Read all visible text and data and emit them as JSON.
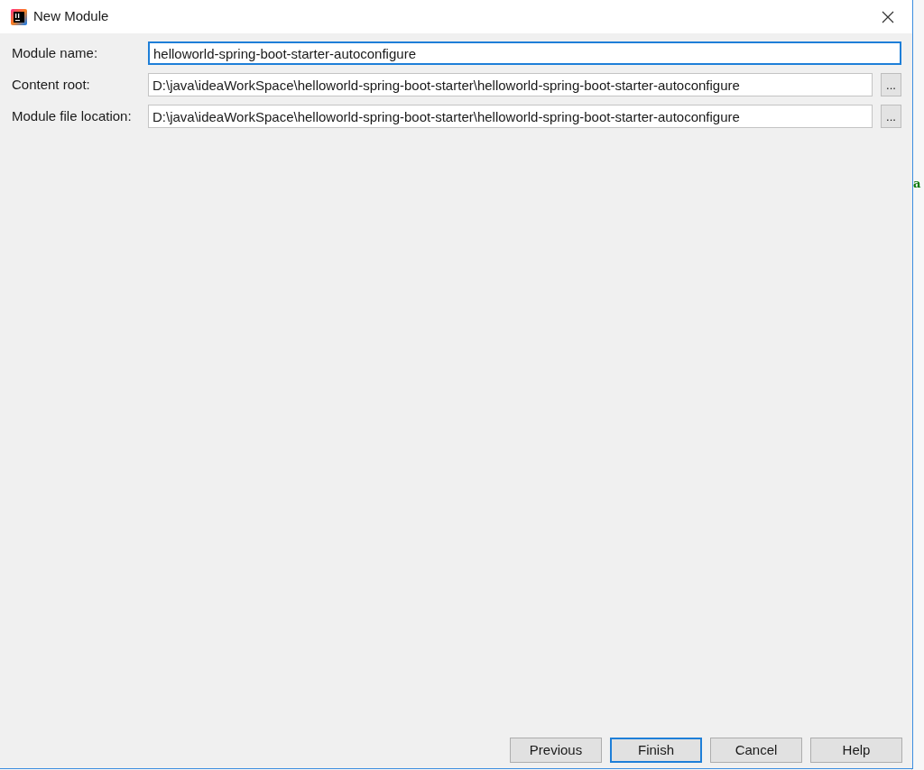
{
  "window": {
    "title": "New Module"
  },
  "fields": [
    {
      "label": "Module name:",
      "value": "helloworld-spring-boot-starter-autoconfigure",
      "focused": true
    },
    {
      "label": "Content root:",
      "value": "D:\\java\\ideaWorkSpace\\helloworld-spring-boot-starter\\helloworld-spring-boot-starter-autoconfigure",
      "focused": false,
      "browse_label": "..."
    },
    {
      "label": "Module file location:",
      "value": "D:\\java\\ideaWorkSpace\\helloworld-spring-boot-starter\\helloworld-spring-boot-starter-autoconfigure",
      "focused": false,
      "browse_label": "..."
    }
  ],
  "buttons": [
    {
      "label": "Previous",
      "default": false
    },
    {
      "label": "Finish",
      "default": true
    },
    {
      "label": "Cancel",
      "default": false
    },
    {
      "label": "Help",
      "default": false
    }
  ],
  "background_window": {
    "text_fragment": "a"
  }
}
